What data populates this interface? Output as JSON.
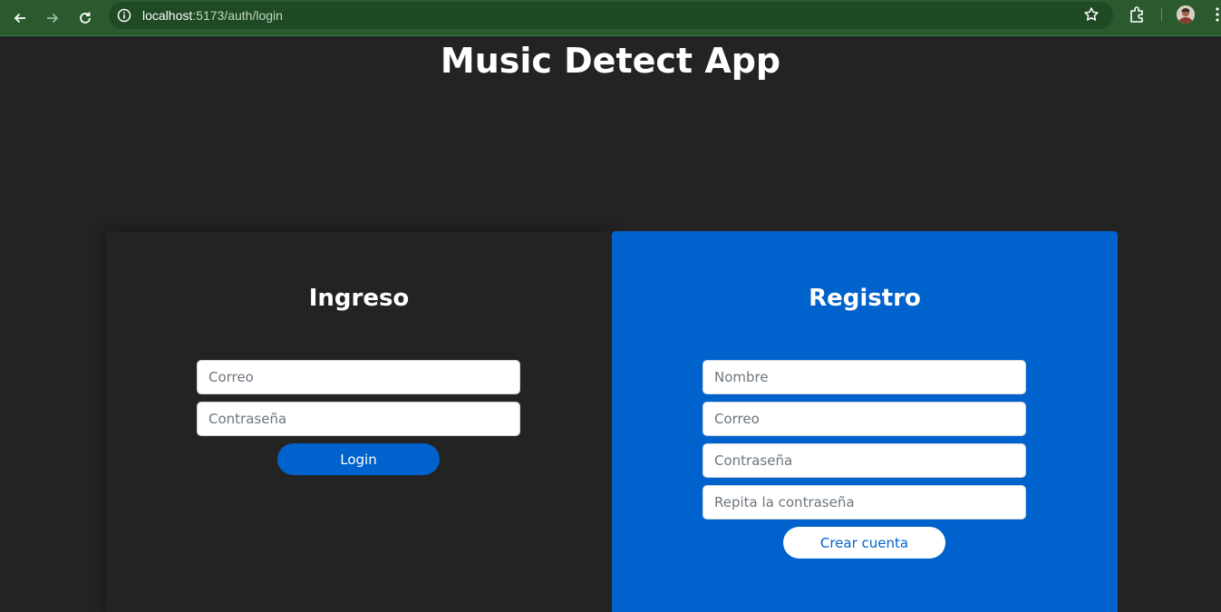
{
  "browser": {
    "url_host": "localhost",
    "url_path": ":5173/auth/login",
    "icons": [
      "back-icon",
      "forward-icon",
      "reload-icon",
      "site-info-icon",
      "bookmark-star-icon",
      "extensions-icon",
      "profile-avatar",
      "menu-kebab-icon"
    ]
  },
  "page": {
    "title": "Music Detect App"
  },
  "login": {
    "title": "Ingreso",
    "email_placeholder": "Correo",
    "password_placeholder": "Contraseña",
    "submit_label": "Login"
  },
  "register": {
    "title": "Registro",
    "name_placeholder": "Nombre",
    "email_placeholder": "Correo",
    "password_placeholder": "Contraseña",
    "repeat_password_placeholder": "Repita la contraseña",
    "submit_label": "Crear cuenta"
  },
  "colors": {
    "background": "#232323",
    "accent": "#0062cc",
    "chrome": "#2a5a2e"
  }
}
